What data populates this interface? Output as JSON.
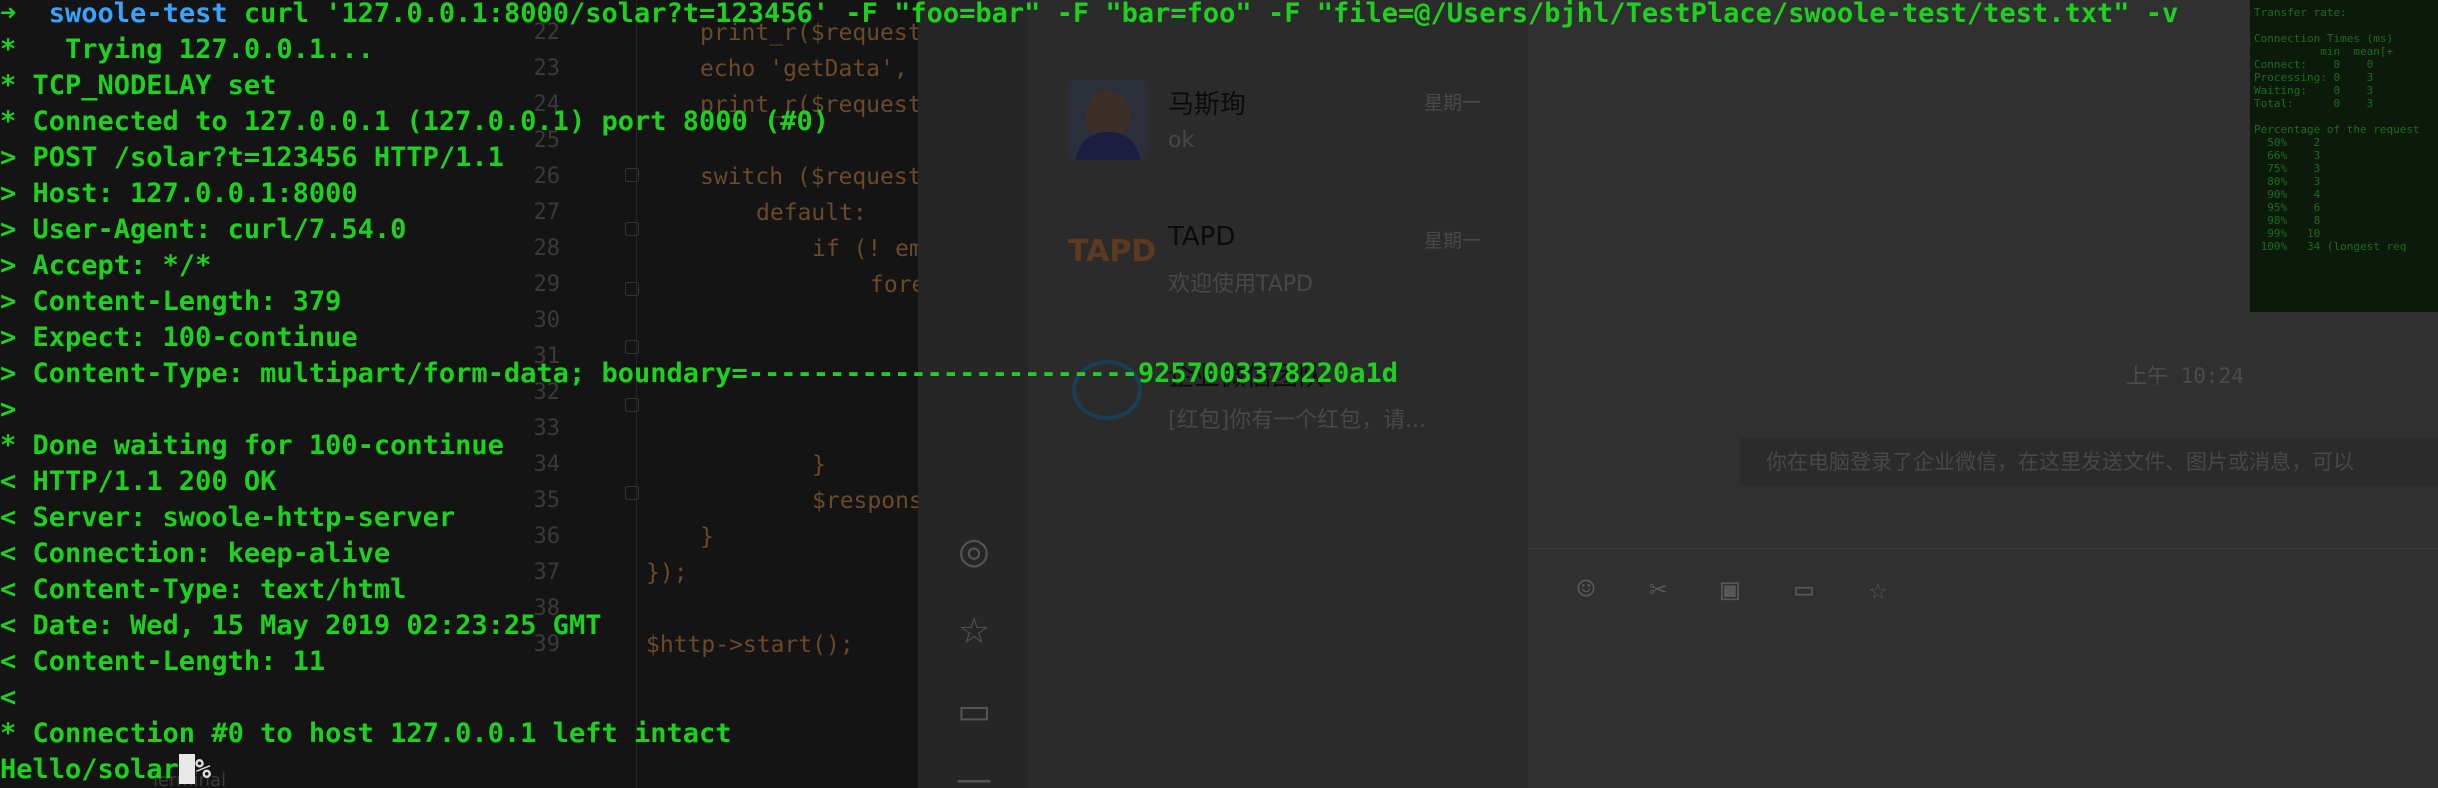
{
  "editor": {
    "line_numbers": [
      "22",
      "23",
      "24",
      "25",
      "26",
      "27",
      "28",
      "29",
      "30",
      "31",
      "32",
      "33",
      "34",
      "35",
      "36",
      "37",
      "38",
      "39"
    ],
    "code": [
      "print_r($request",
      "echo 'getData',",
      "print_r($request",
      "",
      "switch ($request",
      "default:",
      "if (! em",
      "fore",
      "",
      "",
      "",
      "",
      "}",
      "$respons",
      "}",
      "});",
      "",
      "$http->start();"
    ],
    "status_text": "Terminal"
  },
  "chat": {
    "items": [
      {
        "name": "马斯珣",
        "preview": "ok",
        "day": "星期一"
      },
      {
        "name": "TAPD",
        "preview": "欢迎使用TAPD",
        "day": "星期一"
      },
      {
        "name": "企业微信团队",
        "preview": "[红包]你有一个红包，请...",
        "day": ""
      }
    ],
    "time": "上午 10:24",
    "system_message": "你在电脑登录了企业微信，在这里发送文件、图片或消息，可以",
    "rail_icons": [
      "check-circle-icon",
      "star-icon",
      "comment-icon"
    ],
    "toolbar_icons": [
      "emoji-icon",
      "scissors-icon",
      "image-icon",
      "folder-icon",
      "star-icon"
    ]
  },
  "mini_terminal": {
    "text": "Transfer rate:\n\nConnection Times (ms)\n          min  mean[+\nConnect:    0    0\nProcessing: 0    3\nWaiting:    0    3\nTotal:      0    3\n\nPercentage of the request\n  50%    2\n  66%    3\n  75%    3\n  80%    3\n  90%    4\n  95%    6\n  98%    8\n  99%   10\n 100%   34 (longest req"
  },
  "terminal": {
    "prompt_arrow": "➜",
    "prompt_dir": "swoole-test",
    "command": "curl '127.0.0.1:8000/solar?t=123456' -F \"foo=bar\" -F \"bar=foo\" -F \"file=@/Users/bjhl/TestPlace/swoole-test/test.txt\" -v",
    "lines": [
      "*   Trying 127.0.0.1...",
      "* TCP_NODELAY set",
      "* Connected to 127.0.0.1 (127.0.0.1) port 8000 (#0)",
      "> POST /solar?t=123456 HTTP/1.1",
      "> Host: 127.0.0.1:8000",
      "> User-Agent: curl/7.54.0",
      "> Accept: */*",
      "> Content-Length: 379",
      "> Expect: 100-continue",
      "> Content-Type: multipart/form-data; boundary=------------------------9257003378220a1d",
      ">",
      "* Done waiting for 100-continue",
      "< HTTP/1.1 200 OK",
      "< Server: swoole-http-server",
      "< Connection: keep-alive",
      "< Content-Type: text/html",
      "< Date: Wed, 15 May 2019 02:23:25 GMT",
      "< Content-Length: 11",
      "<",
      "* Connection #0 to host 127.0.0.1 left intact"
    ],
    "output": "Hello/solar",
    "prompt_end": "%"
  }
}
